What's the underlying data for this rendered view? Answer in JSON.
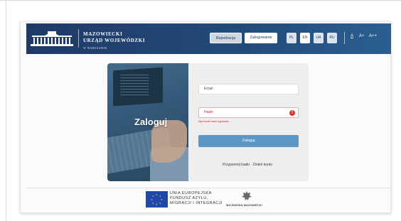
{
  "header": {
    "logo_line1": "MAZOWIECKI",
    "logo_line2": "URZĄD WOJEWÓDZKI",
    "logo_line3": "W WARSZAWIE",
    "register_label": "Rejestracja",
    "login_label": "Zalogowanie",
    "languages": [
      "PL",
      "EN",
      "UA",
      "RU"
    ],
    "active_language": "EN",
    "font_sizes": [
      "A",
      "A+",
      "A++"
    ],
    "colors": {
      "bar_start": "#1f3a67",
      "bar_end": "#2a5f92"
    }
  },
  "login": {
    "image_title": "Zaloguj",
    "email_placeholder": "Email",
    "password_placeholder": "Hasło",
    "password_error": "Wprowadź hasło logowania",
    "submit_label": "Zaloguj",
    "forgot_links": "Przypomnij hasło · Zmień konto",
    "colors": {
      "submit": "#5d97c6",
      "error": "#cc2b2b"
    }
  },
  "footer": {
    "eu_line1": "UNIA EUROPEJSKA",
    "eu_line2": "FUNDUSZ AZYLU,",
    "eu_line3": "MIGRACJI I INTEGRACJI",
    "emblem_label": "WOJEWODA MAZOWIECKI"
  }
}
